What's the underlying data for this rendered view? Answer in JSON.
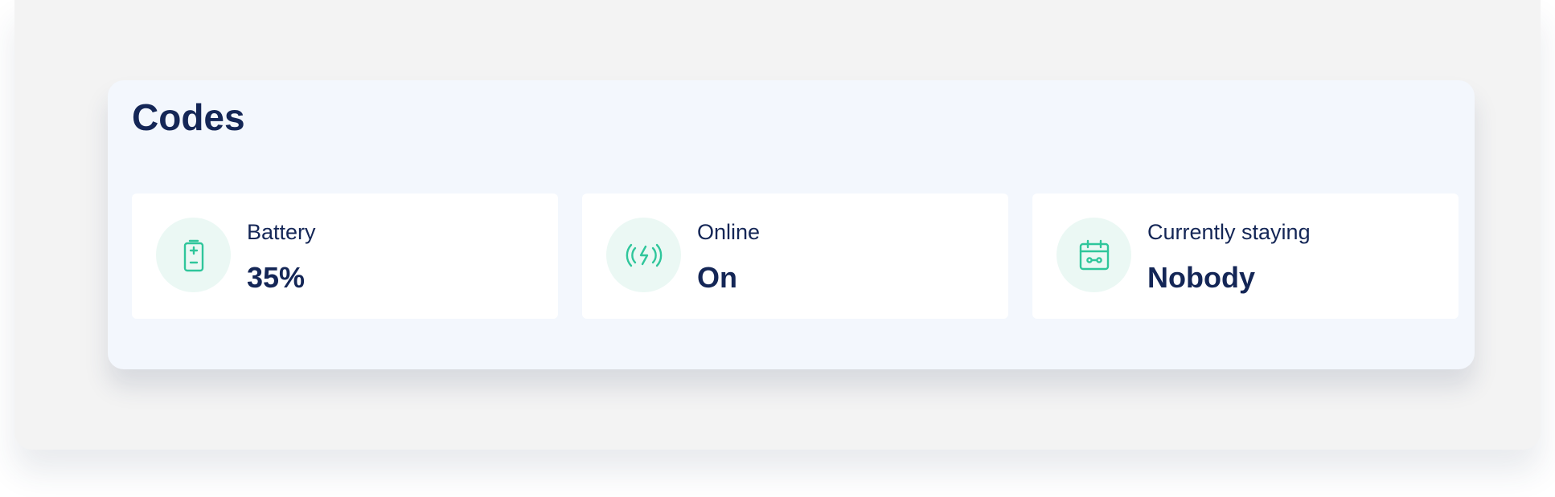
{
  "panel": {
    "title": "Codes"
  },
  "cards": [
    {
      "icon": "battery-icon",
      "label": "Battery",
      "value": "35%"
    },
    {
      "icon": "wireless-charging-icon",
      "label": "Online",
      "value": "On"
    },
    {
      "icon": "calendar-icon",
      "label": "Currently staying",
      "value": "Nobody"
    }
  ],
  "colors": {
    "text": "#142656",
    "accent": "#2fc69b",
    "icon_bg": "#ebf8f4",
    "panel_bg": "#f3f7fd",
    "frame_bg": "#f3f3f3",
    "card_bg": "#ffffff"
  }
}
